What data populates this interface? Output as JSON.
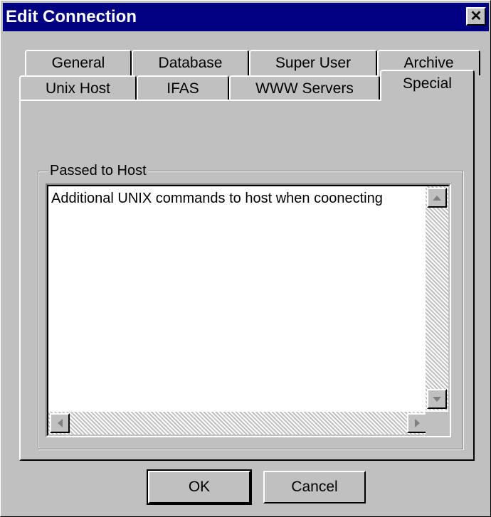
{
  "window": {
    "title": "Edit Connection",
    "close_glyph": "✕"
  },
  "tabs": {
    "row_back": [
      "General",
      "Database",
      "Super User",
      "Archive"
    ],
    "row_front": [
      "Unix Host",
      "IFAS",
      "WWW Servers",
      "Special"
    ],
    "active": "Special"
  },
  "group": {
    "label": "Passed to Host",
    "text": "Additional UNIX commands to host when coonecting"
  },
  "buttons": {
    "ok": "OK",
    "cancel": "Cancel"
  },
  "icons": {
    "scroll_up": "arrow-up-icon",
    "scroll_down": "arrow-down-icon",
    "scroll_left": "arrow-left-icon",
    "scroll_right": "arrow-right-icon"
  }
}
